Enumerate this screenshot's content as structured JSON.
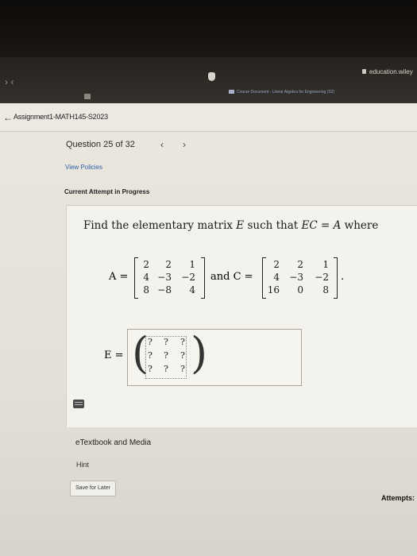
{
  "browser": {
    "url": "education.wiley",
    "tab_label": "Course Document - Linear Algebra for Engineering (S2)",
    "nav_arrows": "› ‹"
  },
  "assignment": {
    "back_icon": "←",
    "title": "Assignment1-MATH145-S2023"
  },
  "question": {
    "counter": "Question 25 of 32",
    "prev": "‹",
    "next": "›",
    "view_policies": "View Policies",
    "status": "Current Attempt in Progress"
  },
  "problem": {
    "prompt_prefix": "Find the elementary matrix ",
    "E": "E",
    "prompt_mid": " such that ",
    "EC": "EC",
    "eq": " = ",
    "A_var": "A",
    "prompt_suffix": " where",
    "A_label": "A =",
    "and_label": "and C =",
    "period": ".",
    "E_label": "E =",
    "matrix_A": [
      [
        "2",
        "2",
        "1"
      ],
      [
        "4",
        "−3",
        "−2"
      ],
      [
        "8",
        "−8",
        "4"
      ]
    ],
    "matrix_C": [
      [
        "2",
        "2",
        "1"
      ],
      [
        "4",
        "−3",
        "−2"
      ],
      [
        "16",
        "0",
        "8"
      ]
    ],
    "matrix_E": [
      [
        "?",
        "?",
        "?"
      ],
      [
        "?",
        "?",
        "?"
      ],
      [
        "?",
        "?",
        "?"
      ]
    ]
  },
  "footer": {
    "etextbook": "eTextbook and Media",
    "hint": "Hint",
    "save_later": "Save for Later",
    "attempts": "Attempts:"
  }
}
